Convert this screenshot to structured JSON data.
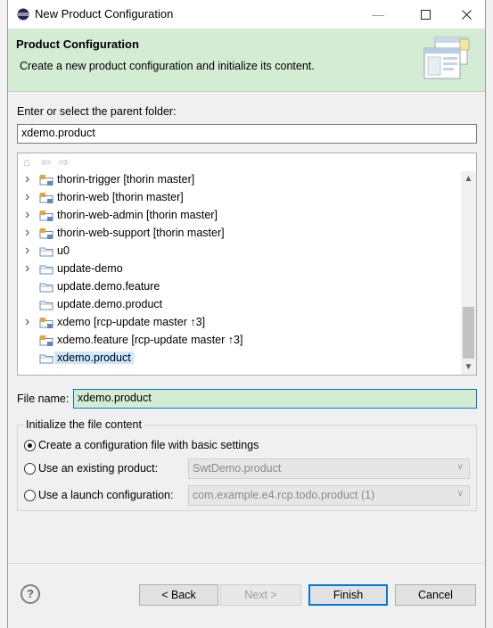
{
  "window": {
    "title": "New Product Configuration"
  },
  "banner": {
    "title": "Product Configuration",
    "description": "Create a new product configuration and initialize its content."
  },
  "parent": {
    "label": "Enter or select the parent folder:",
    "value": "xdemo.product"
  },
  "tree": {
    "items": [
      {
        "label": "thorin-trigger [thorin master]",
        "expandable": true,
        "type": "project"
      },
      {
        "label": "thorin-web [thorin master]",
        "expandable": true,
        "type": "project"
      },
      {
        "label": "thorin-web-admin [thorin master]",
        "expandable": true,
        "type": "project"
      },
      {
        "label": "thorin-web-support [thorin master]",
        "expandable": true,
        "type": "project"
      },
      {
        "label": "u0",
        "expandable": true,
        "type": "folder"
      },
      {
        "label": "update-demo",
        "expandable": true,
        "type": "folder"
      },
      {
        "label": "update.demo.feature",
        "expandable": false,
        "type": "folder"
      },
      {
        "label": "update.demo.product",
        "expandable": false,
        "type": "folder"
      },
      {
        "label": "xdemo [rcp-update master ↑3]",
        "expandable": true,
        "type": "project"
      },
      {
        "label": "xdemo.feature [rcp-update master ↑3]",
        "expandable": false,
        "type": "project"
      },
      {
        "label": "xdemo.product",
        "expandable": false,
        "type": "folder",
        "selected": true
      }
    ]
  },
  "filename": {
    "label": "File name:",
    "value": "xdemo.product"
  },
  "init": {
    "legend": "Initialize the file content",
    "option_basic": "Create a configuration file with basic settings",
    "option_existing": "Use an existing product:",
    "existing_value": "SwtDemo.product",
    "option_launch": "Use a launch configuration:",
    "launch_value": "com.example.e4.rcp.todo.product (1)"
  },
  "buttons": {
    "help": "?",
    "back": "< Back",
    "next": "Next >",
    "finish": "Finish",
    "cancel": "Cancel"
  },
  "colors": {
    "banner": "#d4ecd4",
    "accent": "#0078d7",
    "selection": "#cce8ff",
    "filename_bg": "#d4ecd4"
  }
}
